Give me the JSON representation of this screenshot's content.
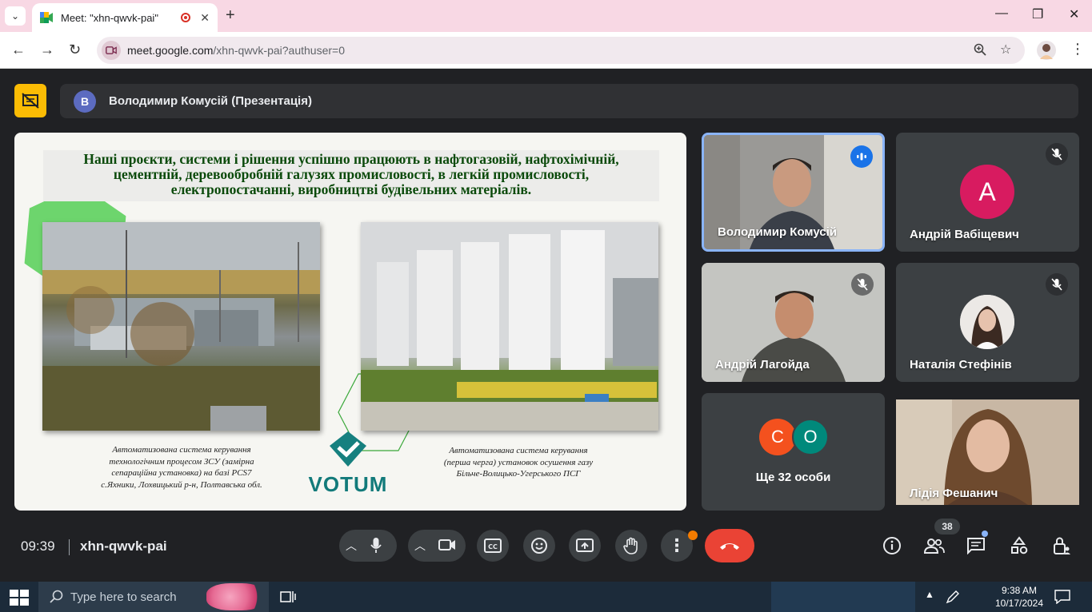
{
  "browser": {
    "tab_title": "Meet: \"xhn-qwvk-pai\"",
    "new_tab": "+",
    "url_domain": "meet.google.com",
    "url_path": "/xhn-qwvk-pai?authuser=0",
    "controls": {
      "minimize": "—",
      "restore": "❐",
      "close": "✕"
    }
  },
  "meet": {
    "presenter_initial": "В",
    "presenter_label": "Володимир Комусій (Презентація)",
    "slide": {
      "heading_lines": [
        "Наші проєкти, системи і рішення успішно працюють в нафтогазовій, нафтохімічній,",
        "цементній, деревообробній галузях промисловості, в легкій промисловості,",
        "електропостачанні, виробництві будівельних матеріалів."
      ],
      "caption_left_lines": [
        "Автоматизована система керування",
        "технологічним процесом ЗСУ (замірна",
        "сепараційна установка) на базі PCS7",
        "с.Яхники, Лохвицький р-н, Полтавська обл."
      ],
      "caption_right_lines": [
        "Автоматизована система керування",
        "(перша черга) установок осушення газу",
        "Більче-Волицько-Угерського ПСГ"
      ],
      "logo_text": "VOTUM"
    },
    "participants": [
      {
        "name": "Володимир Комусій",
        "state": "speaking"
      },
      {
        "name": "Андрій Вабіщевич",
        "initial": "А",
        "avatar_color": "#d81b60",
        "state": "muted"
      },
      {
        "name": "Андрій Лагойда",
        "state": "muted"
      },
      {
        "name": "Наталія Стефінів",
        "state": "muted"
      },
      {
        "name": "Лідія Фешанич",
        "state": "video"
      }
    ],
    "others": {
      "label": "Ще 32 особи",
      "avatars": [
        {
          "initial": "С",
          "color": "#f4511e"
        },
        {
          "initial": "О",
          "color": "#00897b"
        }
      ]
    },
    "bottom": {
      "time": "09:39",
      "meeting_code": "xhn-qwvk-pai",
      "people_count": "38"
    }
  },
  "taskbar": {
    "search_placeholder": "Type here to search",
    "time": "9:38 AM",
    "date": "10/17/2024"
  },
  "colors": {
    "end_call": "#ea4335",
    "presentation_badge": "#fbbc04",
    "speaking_border": "#8ab4f8"
  }
}
